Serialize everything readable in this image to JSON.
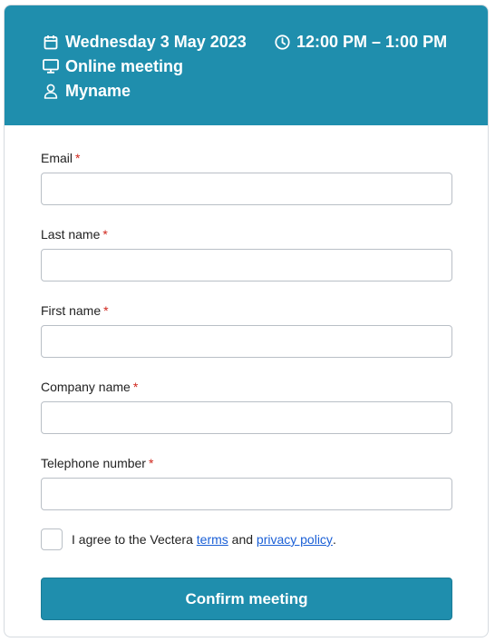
{
  "header": {
    "date": "Wednesday 3 May 2023",
    "time": "12:00 PM – 1:00 PM",
    "location": "Online meeting",
    "host": "Myname",
    "background_color": "#1f8ead",
    "icons": {
      "date": "calendar-icon",
      "time": "clock-icon",
      "location": "monitor-icon",
      "host": "user-icon"
    }
  },
  "form": {
    "fields": [
      {
        "label": "Email",
        "required_mark": "*",
        "value": ""
      },
      {
        "label": "Last name",
        "required_mark": "*",
        "value": ""
      },
      {
        "label": "First name",
        "required_mark": "*",
        "value": ""
      },
      {
        "label": "Company name",
        "required_mark": "*",
        "value": ""
      },
      {
        "label": "Telephone number",
        "required_mark": "*",
        "value": ""
      }
    ],
    "agree": {
      "prefix": "I agree to the Vectera",
      "terms_link": "terms",
      "middle": "and",
      "privacy_link": "privacy policy",
      "suffix": ".",
      "checked": false
    },
    "submit_label": "Confirm meeting",
    "required_color": "#d0271d",
    "link_color": "#1a5fd6"
  }
}
